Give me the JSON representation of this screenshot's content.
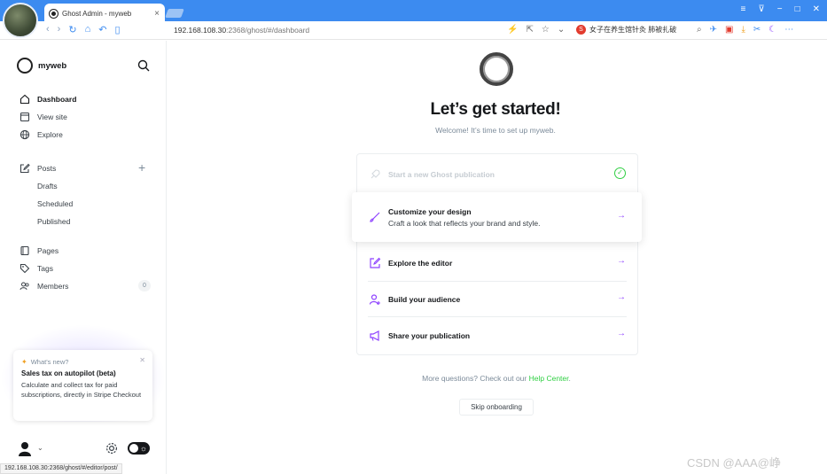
{
  "browser": {
    "tab_title": "Ghost Admin - myweb",
    "tab_close": "×",
    "url_host": "192.168.108.30",
    "url_rest": ":2368/ghost/#/dashboard",
    "search_text": "女子在养生馆针灸 肺被扎破",
    "window_controls": [
      "≡",
      "⊽",
      "−",
      "□",
      "✕"
    ],
    "nav_icons": [
      "back-icon",
      "forward-icon",
      "refresh-icon",
      "home-icon",
      "undo-icon",
      "reader-icon"
    ]
  },
  "sidebar": {
    "brand": "myweb",
    "nav": [
      {
        "label": "Dashboard",
        "icon": "home-icon",
        "active": true
      },
      {
        "label": "View site",
        "icon": "window-icon"
      },
      {
        "label": "Explore",
        "icon": "globe-icon"
      }
    ],
    "posts_label": "Posts",
    "posts_sub": [
      "Drafts",
      "Scheduled",
      "Published"
    ],
    "content_nav": [
      {
        "label": "Pages",
        "icon": "page-icon"
      },
      {
        "label": "Tags",
        "icon": "tag-icon"
      },
      {
        "label": "Members",
        "icon": "members-icon"
      }
    ],
    "members_count": "0",
    "whats_new": {
      "header": "What's new?",
      "title": "Sales tax on autopilot (beta)",
      "body": "Calculate and collect tax for paid subscriptions, directly in Stripe Checkout"
    }
  },
  "main": {
    "headline": "Let’s get started!",
    "subline": "Welcome! It’s time to set up myweb.",
    "steps": [
      {
        "title": "Start a new Ghost publication",
        "done": true
      },
      {
        "title": "Customize your design",
        "desc": "Craft a look that reflects your brand and style."
      },
      {
        "title": "Explore the editor"
      },
      {
        "title": "Build your audience"
      },
      {
        "title": "Share your publication"
      }
    ],
    "help_prefix": "More questions? Check out our ",
    "help_link": "Help Center",
    "help_suffix": ".",
    "skip_label": "Skip onboarding"
  },
  "statusbar": "192.168.108.30:2368/ghost/#/editor/post/",
  "watermark": "CSDN @AAA@峥",
  "colors": {
    "accent": "#8e42ff",
    "green": "#30cf43",
    "browser_blue": "#3c8bf0"
  }
}
